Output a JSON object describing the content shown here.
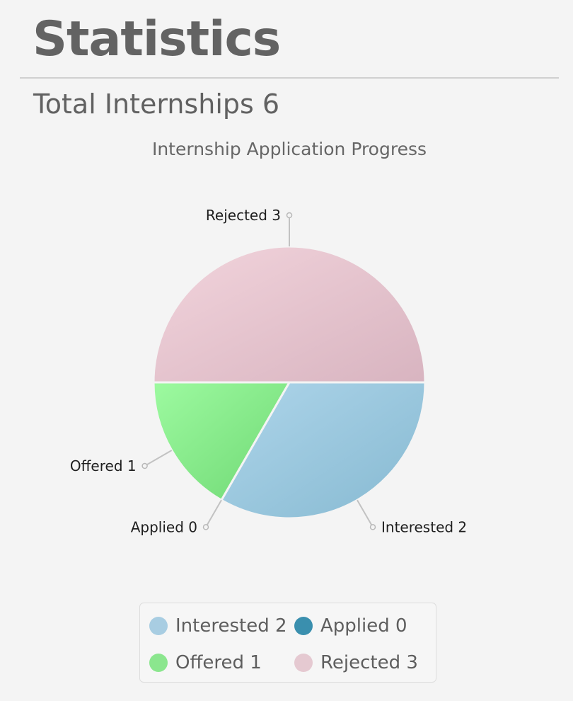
{
  "header": {
    "title": "Statistics",
    "total_label": "Total Internships 6"
  },
  "chart_data": {
    "type": "pie",
    "title": "Internship Application Progress",
    "categories": [
      "Interested",
      "Applied",
      "Offered",
      "Rejected"
    ],
    "values": [
      2,
      0,
      1,
      3
    ],
    "slice_labels": [
      "Interested 2",
      "Applied 0",
      "Offered 1",
      "Rejected 3"
    ],
    "colors": [
      "#9fc9e0",
      "#3a90ae",
      "#86e48a",
      "#e6c7d0"
    ],
    "legend": {
      "placement": "bottom",
      "items": [
        {
          "label": "Interested 2",
          "color": "#a8cde2"
        },
        {
          "label": "Applied 0",
          "color": "#3a8fae"
        },
        {
          "label": "Offered 1",
          "color": "#8be68e"
        },
        {
          "label": "Rejected 3",
          "color": "#e5c9d1"
        }
      ]
    }
  }
}
